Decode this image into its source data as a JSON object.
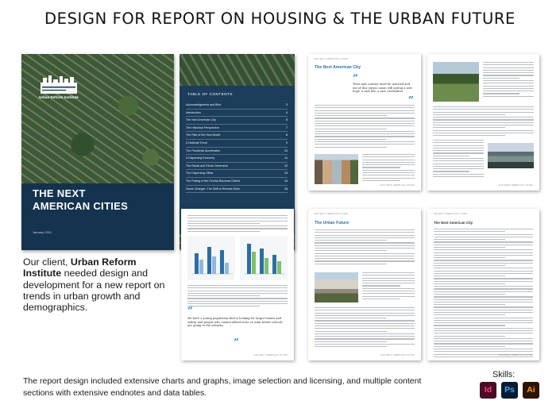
{
  "headline": "DESIGN FOR REPORT ON HOUSING & THE URBAN FUTURE",
  "cover": {
    "logo_text": "Urban Reform Institute",
    "title_line1": "THE NEXT",
    "title_line2": "AMERICAN CITIES",
    "date": "January 2021",
    "colors": {
      "background": "#14334f"
    }
  },
  "toc": {
    "title": "TABLE OF CONTENTS",
    "items": [
      {
        "label": "Acknowledgments and Bios",
        "page": "3"
      },
      {
        "label": "Introduction",
        "page": "4"
      },
      {
        "label": "The Next American City",
        "page": "5"
      },
      {
        "label": "The Historical Perspective",
        "page": "7"
      },
      {
        "label": "The Rise of the New Model",
        "page": "8"
      },
      {
        "label": "A National Trend",
        "page": "9"
      },
      {
        "label": "The Pandemic Accelerates",
        "page": "10"
      },
      {
        "label": "A Dispersing Economy",
        "page": "11"
      },
      {
        "label": "The Racial and Ethnic Dimension",
        "page": "12"
      },
      {
        "label": "The Dispersing Office",
        "page": "13"
      },
      {
        "label": "The Fading of the Central Business District",
        "page": "14"
      },
      {
        "label": "Game Changer: The Shift to Remote Work",
        "page": "15"
      }
    ]
  },
  "pages": {
    "p1_title": "The Next American City",
    "p1_quote": "Town and country must be married and out of this joyous union will spring a new hope, a new life, a new civilization.",
    "p4_title": "The Urban Future",
    "p4_quote": "We have a young population that is looking for larger homes and safety, and people who cannot afford more or want better schools are going to the suburbs.",
    "p5_title": "The Next American City",
    "header_label": "THE NEXT AMERICAN CITIES",
    "footer_label": "THE NEXT AMERICAN CITIES"
  },
  "client": {
    "prefix": "Our client, ",
    "name": "Urban Reform Institute",
    "rest": " needed design and development for a new report on trends in urban growth and demographics."
  },
  "summary": "The report design included extensive charts and graphs, image selection and licensing, and multiple content sections with extensive endnotes and data tables.",
  "skills": {
    "label": "Skills:",
    "items": [
      {
        "abbr": "Id",
        "color": "#ff3a86"
      },
      {
        "abbr": "Ps",
        "color": "#31a8ff"
      },
      {
        "abbr": "Ai",
        "color": "#ff9a00"
      }
    ]
  }
}
